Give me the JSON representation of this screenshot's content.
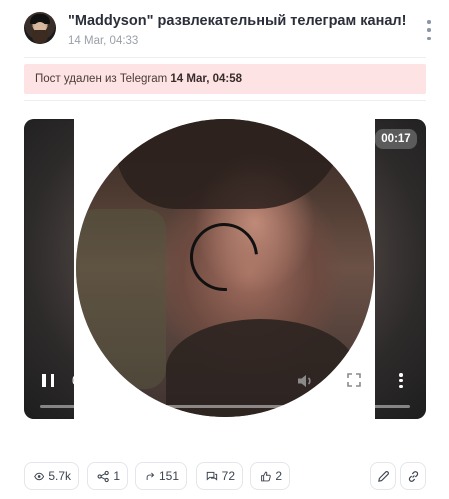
{
  "post": {
    "channel_title": "\"Maddyson\" развлекательный телеграм канал!",
    "date": "14 Mar, 04:33"
  },
  "deleted_notice": {
    "prefix": "Пост удален из Telegram",
    "date": "14 Mar, 04:58"
  },
  "video": {
    "duration": "00:17",
    "current_time": "0:00",
    "progress": 0
  },
  "stats": {
    "views": "5.7k",
    "shares": "1",
    "forwards": "151",
    "comments": "72",
    "reactions": "2"
  },
  "icons": [
    "avatar",
    "more-vertical-icon",
    "pause-icon",
    "volume-icon",
    "fullscreen-icon",
    "eye-icon",
    "share-icon",
    "forward-icon",
    "comment-icon",
    "like-icon",
    "edit-icon",
    "link-icon"
  ],
  "colors": {
    "deleted_banner_bg": "#fde3e3",
    "border": "#e3e6ea",
    "muted_text": "#9aa0a8"
  }
}
